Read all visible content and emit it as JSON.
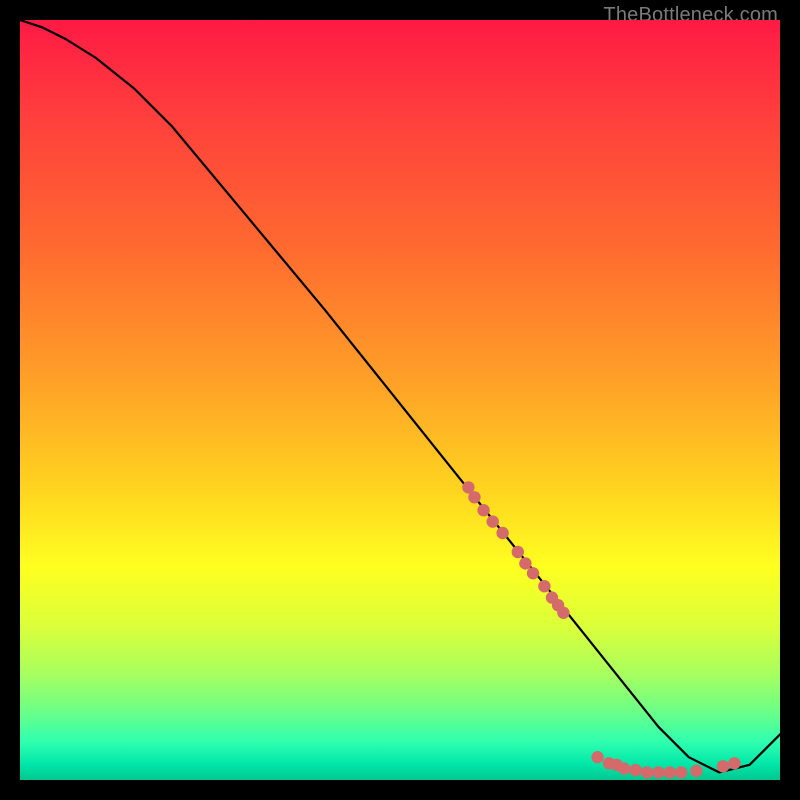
{
  "watermark": "TheBottleneck.com",
  "chart_data": {
    "type": "line",
    "title": "",
    "xlabel": "",
    "ylabel": "",
    "xlim": [
      0,
      100
    ],
    "ylim": [
      0,
      100
    ],
    "series": [
      {
        "name": "curve",
        "x": [
          0,
          3,
          6,
          10,
          15,
          20,
          30,
          40,
          50,
          60,
          68,
          72,
          76,
          80,
          84,
          88,
          92,
          96,
          100
        ],
        "y": [
          100,
          99,
          97.5,
          95,
          91,
          86,
          74,
          62,
          49.5,
          37,
          27,
          22,
          17,
          12,
          7,
          3,
          1,
          2,
          6
        ]
      }
    ],
    "scatter_points": [
      {
        "x": 59,
        "y": 38.5
      },
      {
        "x": 59.8,
        "y": 37.2
      },
      {
        "x": 61,
        "y": 35.5
      },
      {
        "x": 62.2,
        "y": 34
      },
      {
        "x": 63.5,
        "y": 32.5
      },
      {
        "x": 65.5,
        "y": 30
      },
      {
        "x": 66.5,
        "y": 28.5
      },
      {
        "x": 67.5,
        "y": 27.2
      },
      {
        "x": 69,
        "y": 25.5
      },
      {
        "x": 70,
        "y": 24
      },
      {
        "x": 70.8,
        "y": 23
      },
      {
        "x": 71.5,
        "y": 22
      },
      {
        "x": 76,
        "y": 3
      },
      {
        "x": 77.5,
        "y": 2.2
      },
      {
        "x": 78.5,
        "y": 2
      },
      {
        "x": 79.5,
        "y": 1.5
      },
      {
        "x": 81,
        "y": 1.3
      },
      {
        "x": 82.5,
        "y": 1
      },
      {
        "x": 84,
        "y": 1
      },
      {
        "x": 85.5,
        "y": 1
      },
      {
        "x": 87,
        "y": 1
      },
      {
        "x": 89,
        "y": 1.2
      },
      {
        "x": 92.5,
        "y": 1.8
      },
      {
        "x": 94,
        "y": 2.2
      }
    ],
    "colors": {
      "curve": "#000000",
      "points": "#d46a6a"
    }
  }
}
